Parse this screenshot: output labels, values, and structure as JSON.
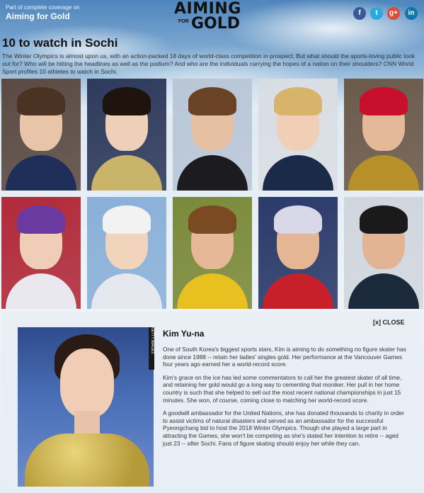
{
  "header": {
    "tagline": "Part of complete coverage on",
    "brand": "Aiming for Gold",
    "logo_line1": "AIMING",
    "logo_line2": "FOR",
    "logo_line3": "GOLD"
  },
  "social": [
    {
      "label": "f",
      "icon": "facebook-icon",
      "color": "#3b5998"
    },
    {
      "label": "t",
      "icon": "twitter-icon",
      "color": "#2aa9e0"
    },
    {
      "label": "g+",
      "icon": "google-plus-icon",
      "color": "#dd4b39"
    },
    {
      "label": "in",
      "icon": "linkedin-icon",
      "color": "#0e76a8"
    }
  ],
  "page": {
    "title": "10 to watch in Sochi",
    "intro": "The Winter Olympics is almost upon us, with an action-packed 18 days of world-class competition in prospect. But what should the sports-loving public look out for? Who will be hitting the headlines as well as the podium? And who are the individuals carrying the hopes of a nation on their shoulders? CNN World Sport profiles 10 athletes to watch in Sochi."
  },
  "athletes": [
    {
      "bg": "#5a4a43",
      "skin": "#e8c4a8",
      "hair": "#4a3322",
      "clothes": "#1f2f5a"
    },
    {
      "bg": "#2e3a5c",
      "skin": "#f0cfb8",
      "hair": "#1e130d",
      "clothes": "#c9b46a"
    },
    {
      "bg": "#b8c6d6",
      "skin": "#e6c0a3",
      "hair": "#6a4327",
      "clothes": "#1c1c20"
    },
    {
      "bg": "#d8dde3",
      "skin": "#f0cfb6",
      "hair": "#d8b46a",
      "clothes": "#1c2a4a"
    },
    {
      "bg": "#6a5a4a",
      "skin": "#e4b898",
      "hair": "#c8102e",
      "clothes": "#b8902a"
    },
    {
      "bg": "#b02a3a",
      "skin": "#f0cdb6",
      "hair": "#6a3aa0",
      "clothes": "#e8e8ee"
    },
    {
      "bg": "#8ab0d8",
      "skin": "#f2d4bc",
      "hair": "#f2f2f2",
      "clothes": "#e6e8f0"
    },
    {
      "bg": "#7a8a3a",
      "skin": "#e6b898",
      "hair": "#7a4a22",
      "clothes": "#e8c020"
    },
    {
      "bg": "#2a3a6a",
      "skin": "#e4b694",
      "hair": "#d8d8e8",
      "clothes": "#c8202a"
    },
    {
      "bg": "#d0d6de",
      "skin": "#e2b493",
      "hair": "#1a1a1a",
      "clothes": "#1a2a3a"
    }
  ],
  "detail": {
    "close_label": "[x] CLOSE",
    "name": "Kim Yu-na",
    "credit": "GETTY IMAGES",
    "paragraphs": [
      "One of South Korea's biggest sports stars, Kim is aiming to do something no figure skater has done since 1988 -- retain her ladies' singles gold. Her performance at the Vancouver Games four years ago earned her a world-record score.",
      "Kim's grace on the ice has led some commentators to call her the greatest skater of all time, and retaining her gold would go a long way to cementing that moniker. Her pull in her home country is such that she helped to sell out the most recent national championships in just 15 minutes. She won, of course, coming close to matching her world-record score.",
      "A goodwill ambassador for the United Nations, she has donated thousands to charity in order to assist victims of natural disasters and served as an ambassador for the successful Pyeongchang bid to host the 2018 Winter Olympics. Though she played a large part in attracting the Games, she won't be competing as she's stated her intention to retire -- aged just 23 -- after Sochi. Fans of figure skating should enjoy her while they can."
    ]
  }
}
